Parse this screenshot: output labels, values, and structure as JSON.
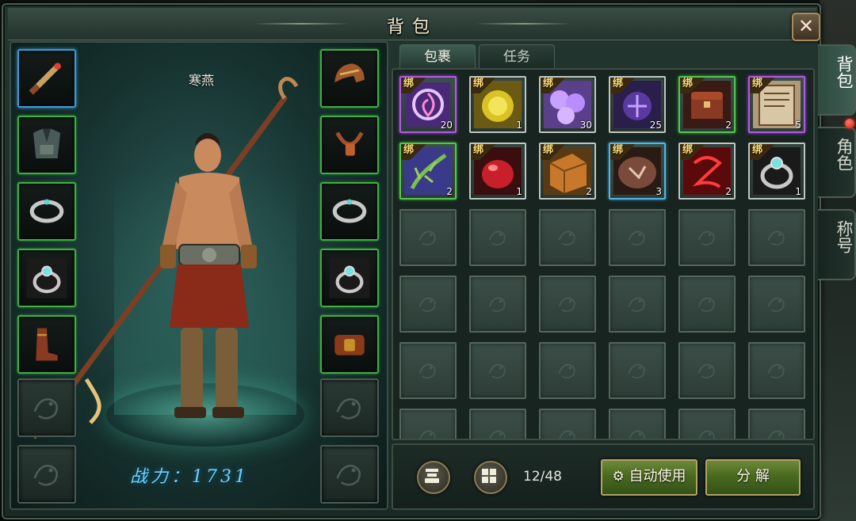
{
  "window": {
    "title": "背包",
    "close_label": "✕"
  },
  "character": {
    "name": "寒燕",
    "power_label": "战力：1731"
  },
  "tabs": [
    {
      "label": "包裹",
      "active": true
    },
    {
      "label": "任务",
      "active": false
    }
  ],
  "side_tabs": [
    {
      "label": "背包",
      "active": true
    },
    {
      "label": "角色",
      "active": false
    },
    {
      "label": "称号",
      "active": false
    }
  ],
  "inventory": {
    "bind_label": "绑",
    "items": [
      {
        "name": "purple-vortex-scroll",
        "count": "20",
        "rarity": "purple",
        "icon": "vortex-icon"
      },
      {
        "name": "golden-coin",
        "count": "1",
        "rarity": "white",
        "icon": "coin-icon"
      },
      {
        "name": "purple-orbs",
        "count": "30",
        "rarity": "white",
        "icon": "orbs-icon"
      },
      {
        "name": "purple-rune",
        "count": "25",
        "rarity": "white",
        "icon": "rune-icon"
      },
      {
        "name": "treasure-chest",
        "count": "2",
        "rarity": "green",
        "icon": "chest-icon"
      },
      {
        "name": "skill-book",
        "count": "5",
        "rarity": "purple",
        "icon": "book-icon"
      },
      {
        "name": "green-herb",
        "count": "2",
        "rarity": "green",
        "icon": "herb-icon"
      },
      {
        "name": "red-potion",
        "count": "1",
        "rarity": "white",
        "icon": "potion-icon"
      },
      {
        "name": "gold-brick",
        "count": "2",
        "rarity": "white",
        "icon": "brick-icon"
      },
      {
        "name": "rune-stone",
        "count": "3",
        "rarity": "blue",
        "icon": "stone-icon"
      },
      {
        "name": "red-sigil",
        "count": "2",
        "rarity": "white",
        "icon": "sigil-icon"
      },
      {
        "name": "silver-ring",
        "count": "1",
        "rarity": "white",
        "icon": "ring-icon"
      }
    ],
    "capacity": "12/48"
  },
  "equipment": {
    "left": [
      {
        "name": "weapon-slot",
        "icon": "sword-icon",
        "state": "blue"
      },
      {
        "name": "armor-slot",
        "icon": "armor-icon",
        "state": "filled"
      },
      {
        "name": "bracelet-slot-left",
        "icon": "bracelet-icon",
        "state": "filled"
      },
      {
        "name": "ring-slot-left",
        "icon": "ring-icon",
        "state": "filled"
      },
      {
        "name": "boots-slot",
        "icon": "boots-icon",
        "state": "filled"
      },
      {
        "name": "empty-slot-left-1",
        "icon": "dragon-emblem-icon",
        "state": "empty"
      },
      {
        "name": "empty-slot-left-2",
        "icon": "dragon-emblem-icon",
        "state": "empty"
      }
    ],
    "right": [
      {
        "name": "helmet-slot",
        "icon": "helmet-icon",
        "state": "filled"
      },
      {
        "name": "necklace-slot",
        "icon": "necklace-icon",
        "state": "filled"
      },
      {
        "name": "bracelet-slot-right",
        "icon": "bracelet-icon",
        "state": "filled"
      },
      {
        "name": "ring-slot-right",
        "icon": "ring-icon",
        "state": "filled"
      },
      {
        "name": "belt-slot",
        "icon": "belt-icon",
        "state": "filled"
      },
      {
        "name": "empty-slot-right-1",
        "icon": "dragon-emblem-icon",
        "state": "empty"
      },
      {
        "name": "empty-slot-right-2",
        "icon": "dragon-emblem-icon",
        "state": "empty"
      }
    ]
  },
  "actions": {
    "sort_icon": "sort-icon",
    "grid_icon": "grid-icon",
    "auto_use_label": "自动使用",
    "decompose_label": "分 解"
  },
  "colors": {
    "accent_gold": "#ffde7a",
    "power_blue": "#6fd3ff",
    "rarity_purple": "#b05be6",
    "rarity_green": "#53c64e",
    "rarity_blue": "#56b3e4"
  }
}
